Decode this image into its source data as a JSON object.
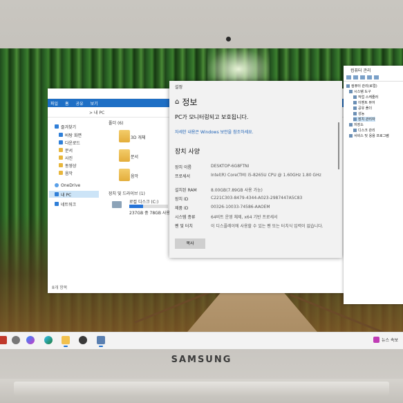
{
  "device": {
    "brand": "SAMSUNG"
  },
  "explorer": {
    "ribbon": [
      "파일",
      "홈",
      "공유",
      "보기"
    ],
    "address": "> 내 PC",
    "nav": [
      {
        "label": "즐겨찾기",
        "icon": "star-icon"
      },
      {
        "label": "바탕 화면",
        "icon": "desktop-icon"
      },
      {
        "label": "다운로드",
        "icon": "download-icon"
      },
      {
        "label": "문서",
        "icon": "document-icon"
      },
      {
        "label": "사진",
        "icon": "picture-icon"
      },
      {
        "label": "동영상",
        "icon": "video-icon"
      },
      {
        "label": "음악",
        "icon": "music-icon"
      },
      {
        "label": "OneDrive",
        "icon": "cloud-icon"
      },
      {
        "label": "내 PC",
        "icon": "pc-icon"
      },
      {
        "label": "네트워크",
        "icon": "network-icon"
      }
    ],
    "folders_header": "폴더 (6)",
    "folders": [
      "3D 개체",
      "문서",
      "음악"
    ],
    "devices_header": "장치 및 드라이브 (1)",
    "drive": {
      "name": "로컬 디스크 (C:)",
      "free": "237GB 중 78GB 사용 가능"
    },
    "status": "8개 항목"
  },
  "settings": {
    "window_title": "설정",
    "header": "정보",
    "protection": "PC가 모니터링되고 보호됩니다.",
    "link": "자세한 내용은 Windows 보안을 참조하세요.",
    "specs_title": "장치 사양",
    "specs": [
      {
        "k": "장치 이름",
        "v": "DESKTOP-6G8FTNI"
      },
      {
        "k": "프로세서",
        "v": "Intel(R) Core(TM) i5-8265U CPU @ 1.60GHz   1.80 GHz"
      },
      {
        "k": "설치된 RAM",
        "v": "8.00GB(7.89GB 사용 가능)"
      },
      {
        "k": "장치 ID",
        "v": "C221C303-8479-4344-A023-2987447A5C83"
      },
      {
        "k": "제품 ID",
        "v": "00326-10033-74586-AAOEM"
      },
      {
        "k": "시스템 종류",
        "v": "64비트 운영 체제, x64 기반 프로세서"
      },
      {
        "k": "펜 및 터치",
        "v": "이 디스플레이에 사용할 수 있는 펜 또는 터치식 입력이 없습니다."
      }
    ],
    "copy_label": "복사"
  },
  "device_manager": {
    "title": "컴퓨터 관리",
    "tree": [
      {
        "label": "컴퓨터 관리(로컬)",
        "level": 0
      },
      {
        "label": "시스템 도구",
        "level": 1
      },
      {
        "label": "작업 스케줄러",
        "level": 2
      },
      {
        "label": "이벤트 뷰어",
        "level": 2
      },
      {
        "label": "공유 폴더",
        "level": 2
      },
      {
        "label": "성능",
        "level": 2
      },
      {
        "label": "장치 관리자",
        "level": 2
      },
      {
        "label": "저장소",
        "level": 1
      },
      {
        "label": "디스크 관리",
        "level": 2
      },
      {
        "label": "서비스 및 응용 프로그램",
        "level": 1
      }
    ]
  },
  "taskbar": {
    "icons": [
      "windows-start-icon",
      "search-icon",
      "task-view-icon",
      "copilot-icon",
      "edge-icon",
      "file-explorer-icon",
      "store-icon",
      "settings-icon",
      "device-manager-icon"
    ],
    "news": "뉴스 속보"
  }
}
